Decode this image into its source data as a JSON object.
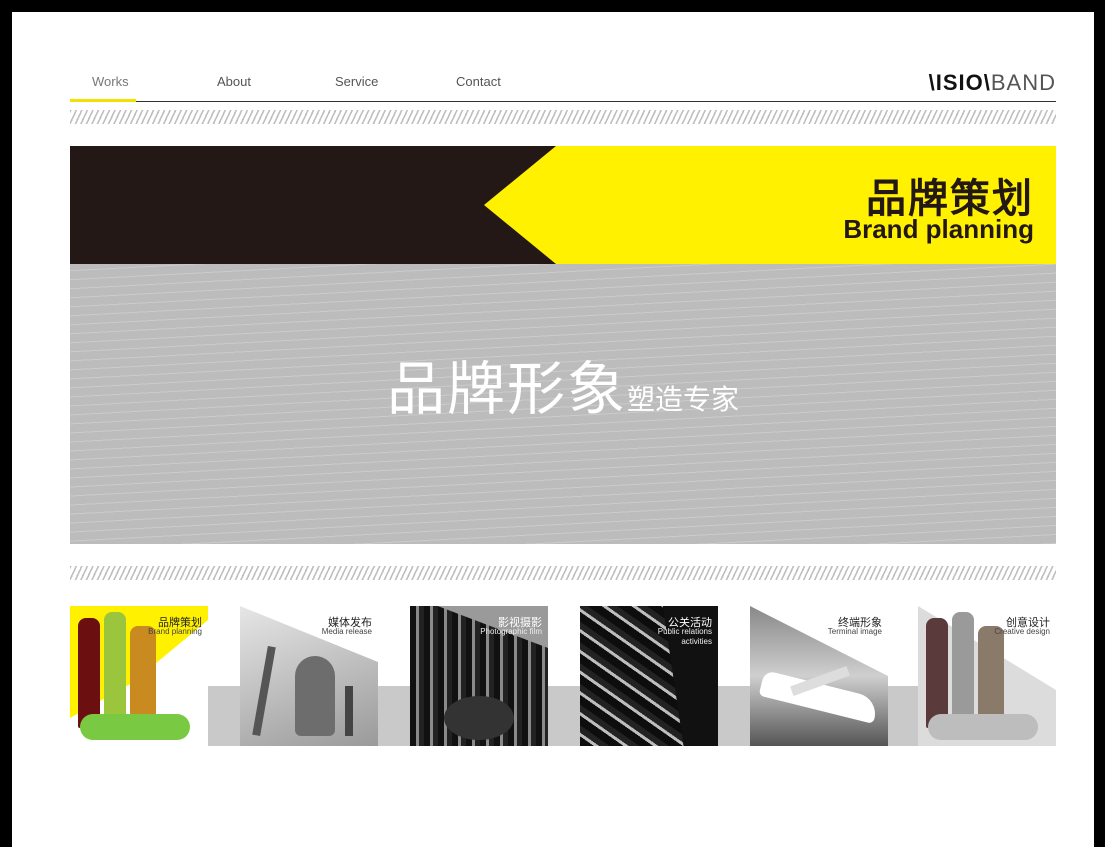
{
  "nav": {
    "items": [
      "Works",
      "About",
      "Service",
      "Contact"
    ],
    "logo_bold": "\\ISIO\\",
    "logo_light": "BAND"
  },
  "hero": {
    "title_cn": "品牌策划",
    "title_en": "Brand planning",
    "slogan_big": "品牌形象",
    "slogan_small": "塑造专家"
  },
  "tiles": [
    {
      "cn": "品牌策划",
      "en": "Brand planning"
    },
    {
      "cn": "媒体发布",
      "en": "Media release"
    },
    {
      "cn": "影视摄影",
      "en": "Photographic film"
    },
    {
      "cn": "公关活动",
      "en": "Public relations activities"
    },
    {
      "cn": "终端形象",
      "en": "Terminal image"
    },
    {
      "cn": "创意设计",
      "en": "Creative design"
    }
  ],
  "colors": {
    "accent": "#fff100",
    "dark": "#231815",
    "gray": "#bcbcbc"
  }
}
